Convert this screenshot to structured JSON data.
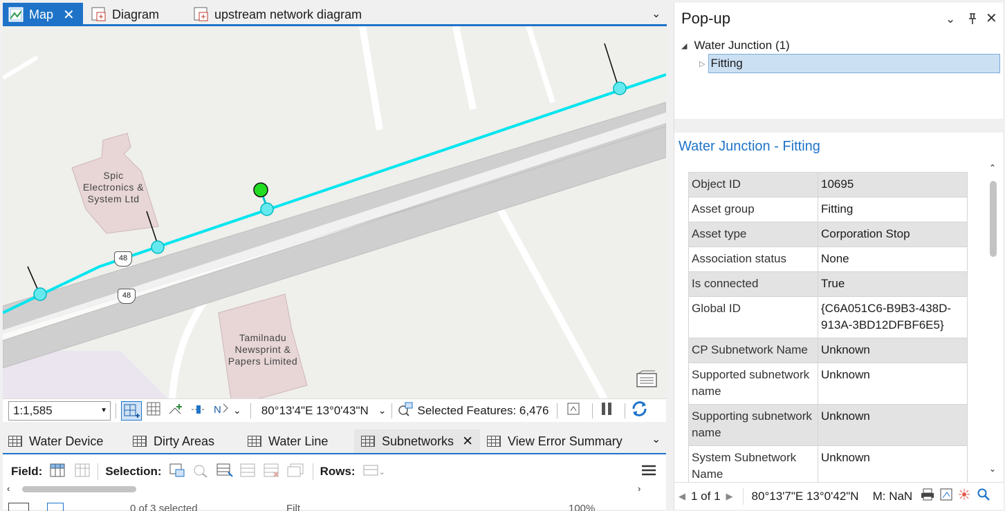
{
  "tabs": [
    {
      "label": "Map",
      "active": true
    },
    {
      "label": "Diagram",
      "active": false
    },
    {
      "label": "upstream network diagram",
      "active": false
    }
  ],
  "map": {
    "labels": {
      "spic": [
        "Spic",
        "Electronics &",
        "System Ltd"
      ],
      "tamilnadu": [
        "Tamilnadu",
        "Newsprint &",
        "Papers Limited"
      ]
    },
    "road_shields": [
      "48",
      "48"
    ]
  },
  "mapbar": {
    "scale": "1:1,585",
    "coordinates": "80°13'4\"E 13°0'43\"N",
    "selected_features": "Selected Features: 6,476"
  },
  "bottom_tabs": [
    {
      "label": "Water Device"
    },
    {
      "label": "Dirty Areas"
    },
    {
      "label": "Water Line"
    },
    {
      "label": "Subnetworks",
      "active": true
    },
    {
      "label": "View Error Summary"
    }
  ],
  "table_toolbar": {
    "field_label": "Field:",
    "selection_label": "Selection:",
    "rows_label": "Rows:",
    "status_fragment": "0 of 3 selected",
    "filter_fragment": "Filt",
    "zoom_fragment": "100%"
  },
  "popup": {
    "title": "Pop-up",
    "tree_root": "Water Junction (1)",
    "tree_child": "Fitting",
    "feature_title": "Water Junction - Fitting",
    "attributes": [
      {
        "key": "Object ID",
        "value": "10695"
      },
      {
        "key": "Asset group",
        "value": "Fitting"
      },
      {
        "key": "Asset type",
        "value": "Corporation Stop"
      },
      {
        "key": "Association status",
        "value": "None"
      },
      {
        "key": "Is connected",
        "value": "True"
      },
      {
        "key": "Global ID",
        "value": "{C6A051C6-B9B3-438D-913A-3BD12DFBF6E5}"
      },
      {
        "key": "CP Subnetwork Name",
        "value": "Unknown"
      },
      {
        "key": "Supported subnetwork name",
        "value": "Unknown"
      },
      {
        "key": "Supporting subnetwork name",
        "value": "Unknown"
      },
      {
        "key": "System Subnetwork Name",
        "value": "Unknown"
      }
    ],
    "footer": {
      "pager": "1 of 1",
      "coordinates": "80°13'7\"E 13°0'42\"N",
      "m_value": "M: NaN"
    }
  },
  "colors": {
    "accent": "#1e73c8",
    "network_line": "#00e5ee",
    "selected_point": "#22dd22"
  }
}
